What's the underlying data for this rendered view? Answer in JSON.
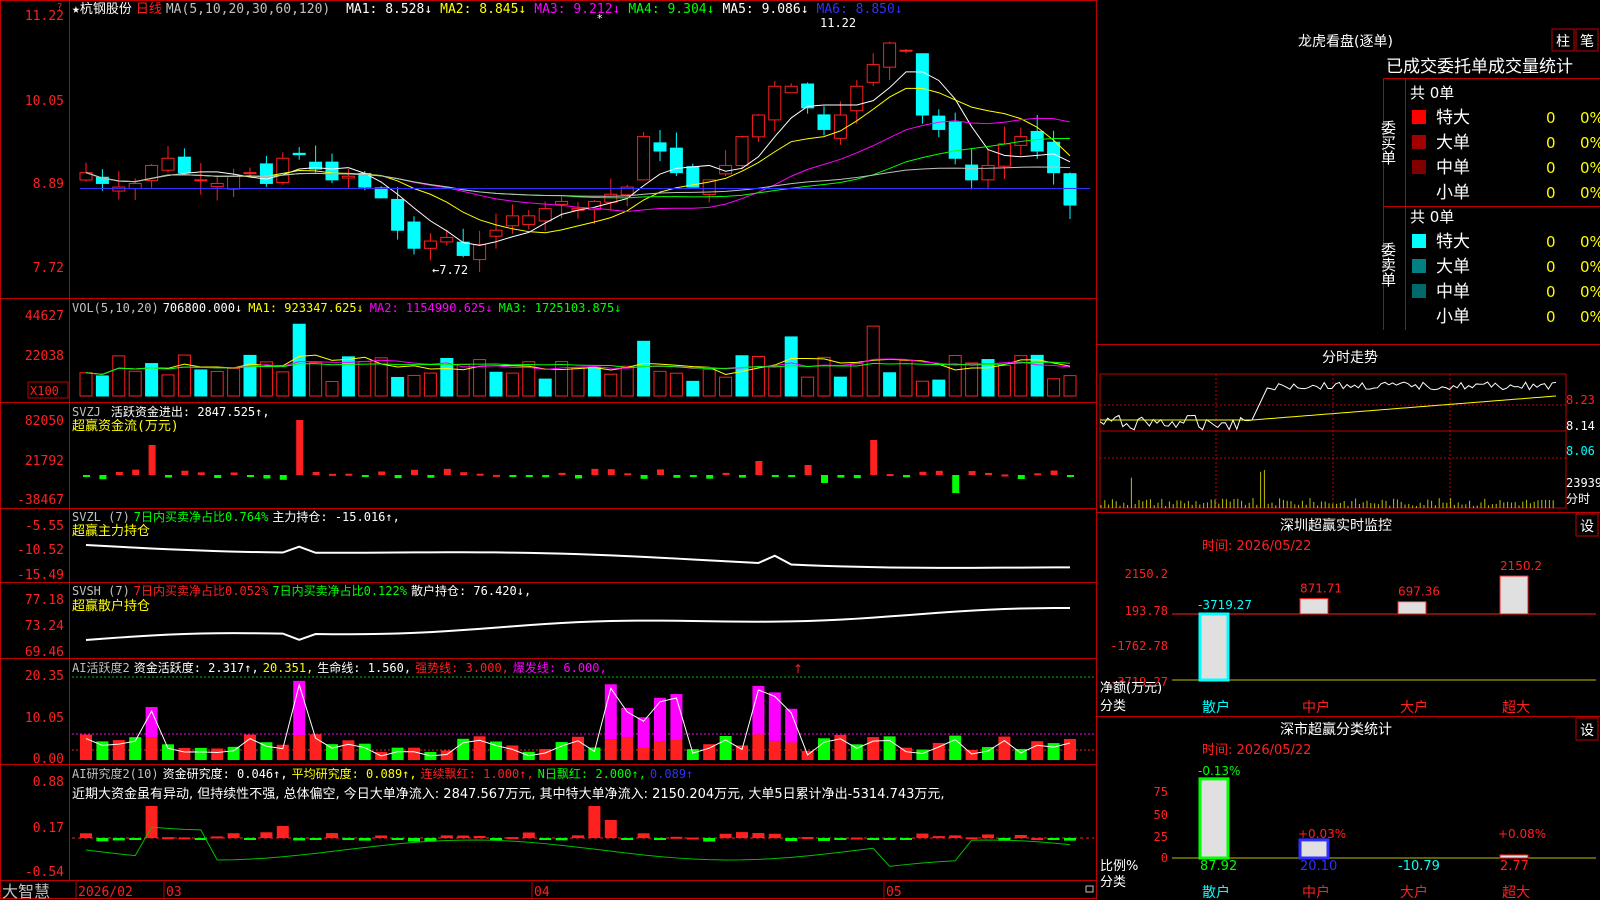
{
  "stock": {
    "name": "杭钢股份",
    "star": "★",
    "period": "日线",
    "ma_label": "MA(5,10,20,30,60,120)",
    "ma": [
      {
        "label": "MA1: 8.528↓",
        "color": "#ffffff"
      },
      {
        "label": "MA2: 8.845↓",
        "color": "#ffff00"
      },
      {
        "label": "MA3: 9.212↓",
        "color": "#ff00ff"
      },
      {
        "label": "MA4: 9.304↓",
        "color": "#00ff00"
      },
      {
        "label": "MA5: 9.086↓",
        "color": "#ffffff"
      },
      {
        "label": "MA6: 8.850↓",
        "color": "#3030ff"
      }
    ],
    "high_note": "11.22",
    "low_note": "←7.72",
    "price_axis": [
      "11.22",
      "10.05",
      "8.89",
      "7.72"
    ]
  },
  "vol": {
    "label": "VOL(5,10,20)",
    "value": "706800.000↓",
    "ma1": "MA1: 923347.625↓",
    "ma2": "MA2: 1154990.625↓",
    "ma3": "MA3: 1725103.875↓",
    "axis": [
      "44627",
      "22038"
    ],
    "unit": "X100"
  },
  "svzj": {
    "label": "SVZJ",
    "desc": "活跃资金进出: 2847.525↑,",
    "sub": "超赢资金流(万元)",
    "axis": [
      "82050",
      "21792",
      "-38467"
    ]
  },
  "svzl": {
    "label": "SVZL (7)",
    "desc1": "7日内买卖净占比0.764%",
    "desc2": "主力持仓: -15.016↑,",
    "sub": "超赢主力持仓",
    "axis": [
      "-5.55",
      "-10.52",
      "-15.49"
    ]
  },
  "svsh": {
    "label": "SVSH (7)",
    "desc1": "7日内买卖净占比0.052%",
    "desc2": "7日内买卖净占比0.122%",
    "desc3": "散户持仓: 76.420↓,",
    "sub": "超赢散户持仓",
    "axis": [
      "77.18",
      "73.24",
      "69.46"
    ]
  },
  "ai1": {
    "label": "AI活跃度2",
    "desc1": "资金活跃度: 2.317↑,",
    "desc2": "20.351,",
    "desc3": "生命线: 1.560,",
    "desc4": "强势线: 3.000,",
    "desc5": "爆发线: 6.000,",
    "axis": [
      "20.35",
      "10.05",
      "0.00"
    ]
  },
  "ai2": {
    "label": "AI研究度2(10)",
    "desc1": "资金研究度: 0.046↑,",
    "desc2": "平均研究度: 0.089↑,",
    "desc3": "连续飘红: 1.000↑,",
    "desc4": "N日飘红: 2.000↑,",
    "desc5": "0.089↑",
    "comment": "近期大资金虽有异动, 但持续性不强, 总体偏空, 今日大单净流入: 2847.567万元, 其中特大单净流入: 2150.204万元, 大单5日累计净出-5314.743万元,",
    "axis": [
      "0.88",
      "0.17",
      "-0.54"
    ]
  },
  "bottom": {
    "brand": "大智慧",
    "dates": [
      "2026/02",
      "03",
      "04",
      "05"
    ]
  },
  "dragon": {
    "title": "龙虎看盘(逐单)",
    "btn1": "柱",
    "btn2": "笔",
    "header": "已成交委托单成交量统计",
    "buy_label": "委买单",
    "sell_label": "委卖单",
    "buy_total": "共 0单",
    "sell_total": "共 0单",
    "buy_rows": [
      {
        "name": "特大",
        "count": "0",
        "pct": "0%",
        "color": "#ff0000"
      },
      {
        "name": "大单",
        "count": "0",
        "pct": "0%",
        "color": "#a00000"
      },
      {
        "name": "中单",
        "count": "0",
        "pct": "0%",
        "color": "#800000"
      },
      {
        "name": "小单",
        "count": "0",
        "pct": "0%",
        "color": "#000000"
      }
    ],
    "sell_rows": [
      {
        "name": "特大",
        "count": "0",
        "pct": "0%",
        "color": "#00ffff"
      },
      {
        "name": "大单",
        "count": "0",
        "pct": "0%",
        "color": "#008080"
      },
      {
        "name": "中单",
        "count": "0",
        "pct": "0%",
        "color": "#006a6a"
      },
      {
        "name": "小单",
        "count": "0",
        "pct": "0%",
        "color": "#000000"
      }
    ]
  },
  "fenshi": {
    "title": "分时走势",
    "axis": [
      "8.23",
      "8.14",
      "8.06"
    ],
    "vol_label": "23939",
    "vol_sub": "分时"
  },
  "sz_monitor": {
    "title": "深圳超赢实时监控",
    "btn": "设",
    "time": "时间: 2026/05/22",
    "axis": [
      "2150.2",
      "193.78",
      "-1762.78",
      "-3719.27"
    ],
    "ylabel": "净额(万元)",
    "xlabel": "分类",
    "cats": [
      "散户",
      "中户",
      "大户",
      "超大"
    ],
    "values": [
      -3719.27,
      871.71,
      697.36,
      2150.2
    ],
    "value_labels": [
      "-3719.27",
      "871.71",
      "697.36",
      "2150.2"
    ]
  },
  "sz_class": {
    "title": "深市超赢分类统计",
    "btn": "设",
    "time": "时间: 2026/05/22",
    "axis": [
      "75",
      "50",
      "25",
      "0"
    ],
    "ylabel": "比例%",
    "xlabel": "分类",
    "cats": [
      "散户",
      "中户",
      "大户",
      "超大"
    ],
    "values": [
      87.92,
      20.1,
      -10.79,
      2.77
    ],
    "value_labels": [
      "87.92",
      "20.10",
      "-10.79",
      "2.77"
    ],
    "top_labels": [
      "-0.13%",
      "+0.03%",
      "",
      "+0.08%"
    ]
  },
  "chart_data": {
    "type": "bar",
    "title": "深圳超赢实时监控",
    "categories": [
      "散户",
      "中户",
      "大户",
      "超大"
    ],
    "series": [
      {
        "name": "净额(万元)",
        "values": [
          -3719.27,
          871.71,
          697.36,
          2150.2
        ]
      },
      {
        "name": "比例%",
        "values": [
          87.92,
          20.1,
          -10.79,
          2.77
        ]
      }
    ]
  }
}
